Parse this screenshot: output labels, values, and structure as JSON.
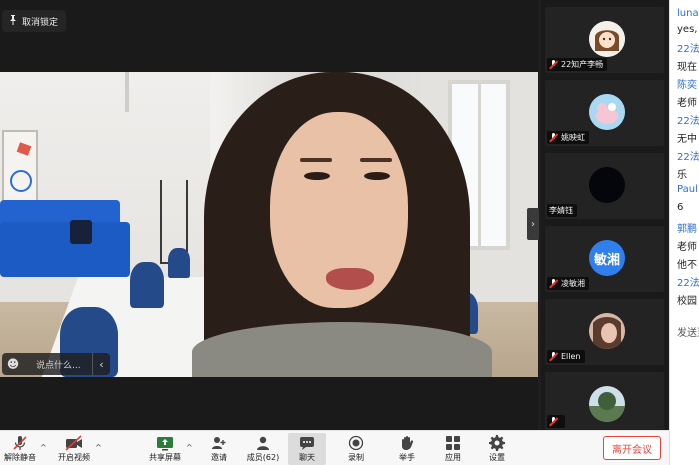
{
  "stage": {
    "unlock_label": "取消锁定",
    "say_placeholder": "说点什么...",
    "collapse_glyph": "›"
  },
  "participants": [
    {
      "name": "22知产李畅",
      "avatar_kind": "cartoon-girl",
      "avatar_color": "#f2f2f2"
    },
    {
      "name": "姚映虹",
      "avatar_kind": "cartoon-pink",
      "avatar_color": "#9fd3f0"
    },
    {
      "name": "李婧钰",
      "avatar_kind": "dark-photo",
      "avatar_color": "#0a0a14"
    },
    {
      "name": "凌敏湘",
      "avatar_kind": "text",
      "avatar_text": "敏湘",
      "avatar_color": "#2f80ed"
    },
    {
      "name": "Ellen",
      "avatar_kind": "photo-face",
      "avatar_color": "#c9a89a"
    },
    {
      "name": "",
      "avatar_kind": "photo-tree",
      "avatar_color": "#6b8a6a"
    }
  ],
  "chat": {
    "lines": [
      {
        "type": "sender",
        "text": "luna"
      },
      {
        "type": "msg",
        "text": "yes,"
      },
      {
        "type": "sender",
        "text": "22法"
      },
      {
        "type": "msg",
        "text": "现在"
      },
      {
        "type": "sender",
        "text": "陈奕"
      },
      {
        "type": "msg",
        "text": "老师"
      },
      {
        "type": "sender",
        "text": "22法"
      },
      {
        "type": "msg",
        "text": "无中"
      },
      {
        "type": "sender",
        "text": "22法"
      },
      {
        "type": "msg",
        "text": "乐"
      },
      {
        "type": "sender",
        "text": "Paul"
      },
      {
        "type": "msg",
        "text": "6"
      },
      {
        "type": "sender",
        "text": "郭鹏"
      },
      {
        "type": "msg",
        "text": "老师"
      },
      {
        "type": "msg",
        "text": "他不"
      },
      {
        "type": "sender",
        "text": "22法"
      },
      {
        "type": "msg",
        "text": "校园"
      }
    ],
    "send_label": "发送至"
  },
  "toolbar": {
    "mute": "解除静音",
    "video": "开启视频",
    "share": "共享屏幕",
    "invite": "邀请",
    "members": "成员(62)",
    "chat": "聊天",
    "record": "录制",
    "raise_hand": "举手",
    "apps": "应用",
    "settings": "设置",
    "leave": "离开会议"
  },
  "colors": {
    "accent_blue": "#2d6fd6",
    "leave_red": "#e8443a",
    "toolbar_bg": "#f7f7f7"
  }
}
